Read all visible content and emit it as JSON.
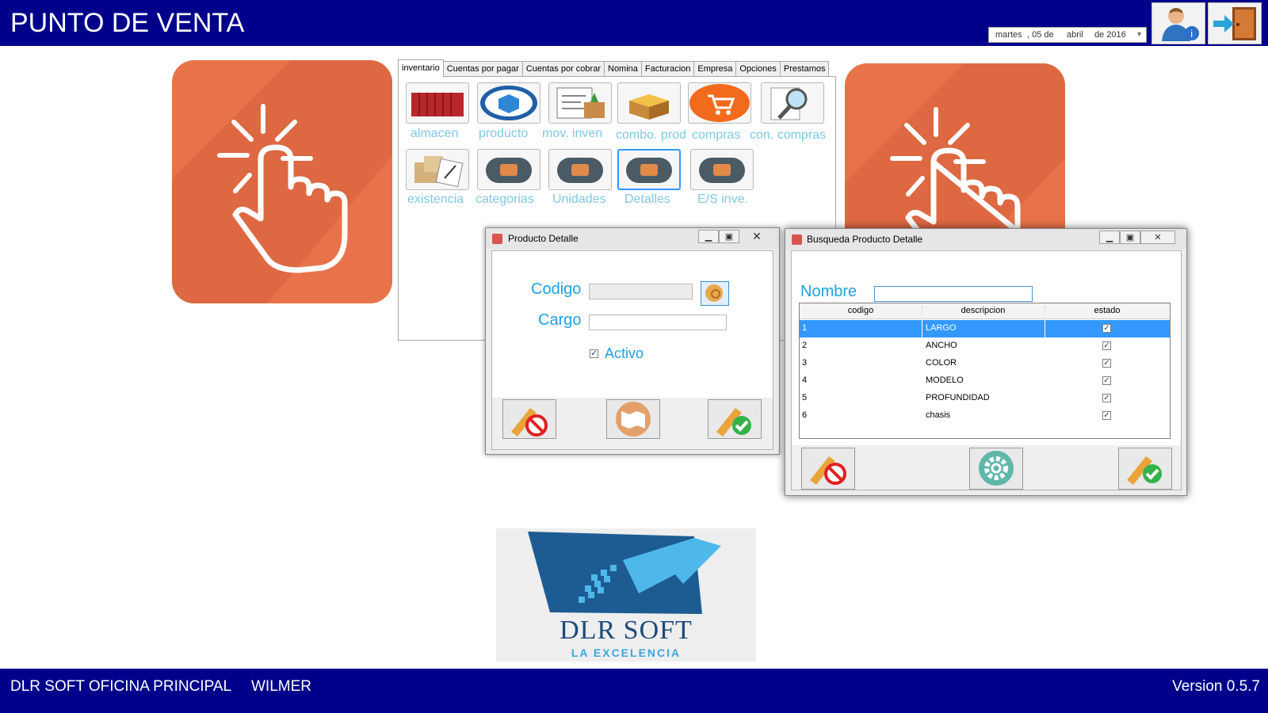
{
  "header": {
    "title": "PUNTO DE VENTA",
    "date": {
      "weekday": "martes",
      "day": ", 05 de",
      "month": "abril",
      "year": "de 2016"
    }
  },
  "tabs": [
    "inventario",
    "Cuentas por pagar",
    "Cuentas por cobrar",
    "Nomina",
    "Facturacion",
    "Empresa",
    "Opciones",
    "Prestamos"
  ],
  "inventory_buttons": [
    {
      "label": "almacen"
    },
    {
      "label": "producto"
    },
    {
      "label": "mov. inven"
    },
    {
      "label": "combo. prod"
    },
    {
      "label": "compras"
    },
    {
      "label": "con. compras"
    },
    {
      "label": "existencia"
    },
    {
      "label": "categorias"
    },
    {
      "label": "Unidades"
    },
    {
      "label": "Detalles"
    },
    {
      "label": "E/S inve."
    }
  ],
  "producto_detalle": {
    "title": "Producto Detalle",
    "codigo_label": "Codigo",
    "codigo_value": "",
    "cargo_label": "Cargo",
    "cargo_value": "",
    "activo_label": "Activo",
    "activo_checked": true
  },
  "busqueda": {
    "title": "Busqueda Producto Detalle",
    "nombre_label": "Nombre",
    "nombre_value": "",
    "columns": [
      "codigo",
      "descripcion",
      "estado"
    ],
    "rows": [
      {
        "codigo": "1",
        "descripcion": "LARGO",
        "estado": true
      },
      {
        "codigo": "2",
        "descripcion": "ANCHO",
        "estado": true
      },
      {
        "codigo": "3",
        "descripcion": "COLOR",
        "estado": true
      },
      {
        "codigo": "4",
        "descripcion": "MODELO",
        "estado": true
      },
      {
        "codigo": "5",
        "descripcion": "PROFUNDIDAD",
        "estado": true
      },
      {
        "codigo": "6",
        "descripcion": "chasis",
        "estado": true
      }
    ],
    "selected_row": 1
  },
  "logo": {
    "name": "DLR SOFT",
    "tagline": "LA EXCELENCIA"
  },
  "footer": {
    "office": "DLR SOFT OFICINA PRINCIPAL",
    "user": "WILMER",
    "version": "Version 0.5.7"
  },
  "colors": {
    "header": "#00008b",
    "accent_text": "#1da1e4",
    "tile": "#e8734a",
    "selection": "#3399ff"
  }
}
